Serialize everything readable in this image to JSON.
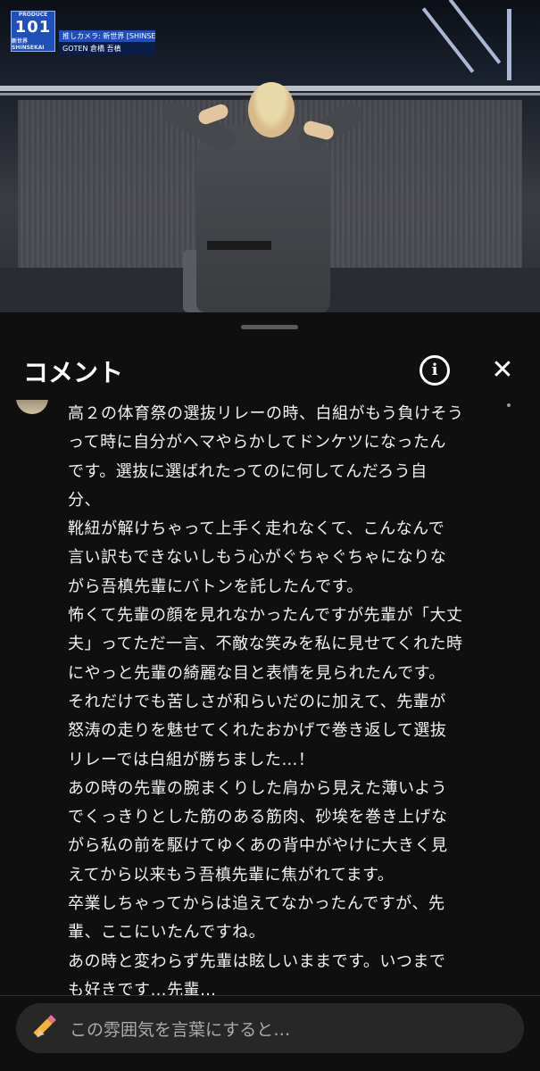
{
  "video": {
    "overlay": {
      "logo_small_top": "PRODUCE",
      "logo_number": "101",
      "logo_sub": "新世界 SHINSEKAI",
      "caption_line1": "推しカメラ: 新世界 [SHINSEKAI]",
      "caption_line2": "GOTEN 倉橋 吾槙"
    }
  },
  "sheet": {
    "title": "コメント",
    "info_icon_glyph": "i",
    "close_icon_glyph": "✕",
    "comment_lines": [
      "高２の体育祭の選抜リレーの時、白組がもう負けそう",
      "って時に自分がヘマやらかしてドンケツになったん",
      "です。選抜に選ばれたってのに何してんだろう自",
      "分、",
      "靴紐が解けちゃって上手く走れなくて、こんなんで",
      "言い訳もできないしもう心がぐちゃぐちゃになりな",
      "がら吾槙先輩にバトンを託したんです。",
      "怖くて先輩の顔を見れなかったんですが先輩が「大丈",
      "夫」ってただ一言、不敵な笑みを私に見せてくれた時",
      "にやっと先輩の綺麗な目と表情を見られたんです。",
      "それだけでも苦しさが和らいだのに加えて、先輩が",
      "怒涛の走りを魅せてくれたおかげで巻き返して選抜",
      "リレーでは白組が勝ちました…！",
      "あの時の先輩の腕まくりした肩から見えた薄いよう",
      "でくっきりとした筋のある筋肉、砂埃を巻き上げな",
      "がら私の前を駆けてゆくあの背中がやけに大きく見",
      "えてから以来もう吾槙先輩に焦がれてます。",
      "卒業しちゃってからは追えてなかったんですが、先",
      "輩、ここにいたんですね。",
      "あの時と変わらず先輩は眩しいままです。いつまで",
      "も好きです…先輩…"
    ],
    "input": {
      "placeholder": "この雰囲気を言葉にすると…"
    }
  }
}
